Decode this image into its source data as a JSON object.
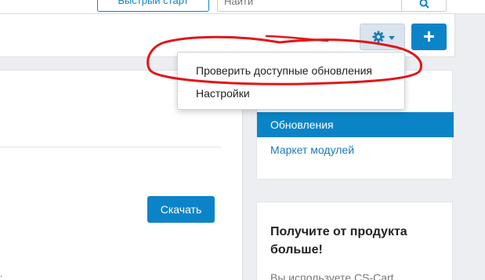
{
  "header": {
    "quick_start_label": "Быстрый старт",
    "search_placeholder": "Найти"
  },
  "toolbar": {
    "settings_icon": "gear-icon",
    "add_icon": "plus-icon"
  },
  "main": {
    "download_label": "Скачать"
  },
  "settings_menu": {
    "items": [
      {
        "label": "Проверить доступные обновления"
      },
      {
        "label": "Настройки"
      }
    ]
  },
  "sidebar": {
    "items": [
      {
        "label": "Обновления",
        "active": true
      },
      {
        "label": "Маркет модулей",
        "active": false
      }
    ]
  },
  "promo": {
    "title": "Получите от продукта больше!",
    "text": "Вы используете CS-Cart"
  },
  "annotation": {
    "color": "#e0161b",
    "shape": "hand-drawn oval around the first menu item"
  },
  "colors": {
    "accent": "#0b84c7",
    "background": "#eceef1"
  }
}
